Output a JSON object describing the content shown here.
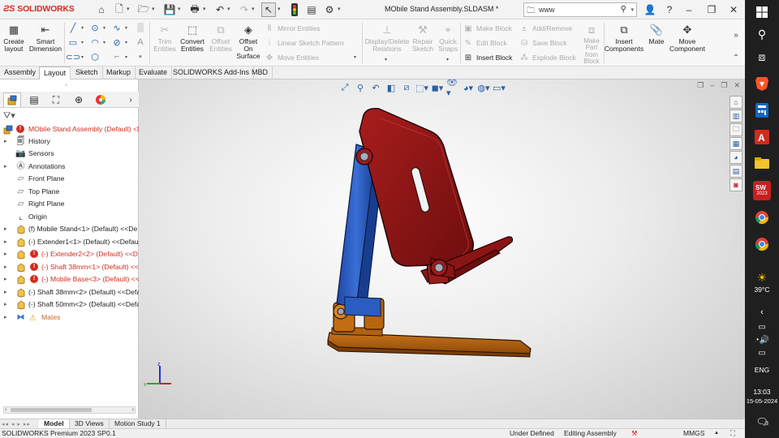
{
  "window": {
    "app_name": "SOLIDWORKS",
    "title": "MObile Stand Assembly.SLDASM *",
    "search_value": "www"
  },
  "ribbon": {
    "create_layout": "Create\nlayout",
    "smart_dimension": "Smart\nDimension",
    "trim_entities": "Trim\nEntities",
    "convert_entities": "Convert\nEntities",
    "offset_entities": "Offset\nEntities",
    "offset_on_surface": "Offset\nOn\nSurface",
    "mirror_entities": "Mirror Entities",
    "linear_sketch_pattern": "Linear Sketch Pattern",
    "move_entities": "Move Entities",
    "display_delete_relations": "Display/Delete\nRelations",
    "repair_sketch": "Repair\nSketch",
    "quick_snaps": "Quick\nSnaps",
    "make_block": "Make Block",
    "edit_block": "Edit Block",
    "insert_block": "Insert Block",
    "add_remove": "Add/Remove",
    "save_block": "Save Block",
    "explode_block": "Explode Block",
    "make_part_from_block": "Make\nPart\nfrom\nBlock",
    "insert_components": "Insert\nComponents",
    "mate": "Mate",
    "move_component": "Move\nComponent"
  },
  "command_tabs": [
    "Assembly",
    "Layout",
    "Sketch",
    "Markup",
    "Evaluate",
    "SOLIDWORKS Add-Ins",
    "MBD"
  ],
  "active_command_tab": "Layout",
  "feature_tree": {
    "root": "MObile Stand Assembly (Default) <Di",
    "items": [
      "History",
      "Sensors",
      "Annotations",
      "Front Plane",
      "Top Plane",
      "Right Plane",
      "Origin",
      "(f) Mobile Stand<1> (Default) <<De",
      "(-) Extender1<1> (Default) <<Defau",
      "(-) Extender2<2> (Default) <<D",
      "(-) Shaft 38mm<1> (Default) <<",
      "(-) Mobile Base<3> (Default) <<",
      "(-) Shaft 38mm<2> (Default) <<Defa",
      "(-) Shaft 50mm<2> (Default) <<Defa",
      "Mates"
    ]
  },
  "bottom_tabs": [
    "Model",
    "3D Views",
    "Motion Study 1"
  ],
  "active_bottom_tab": "Model",
  "status": {
    "version": "SOLIDWORKS Premium 2023 SP0.1",
    "definition": "Under Defined",
    "mode": "Editing Assembly",
    "units": "MMGS"
  },
  "taskbar": {
    "weather": "39°C",
    "language": "ENG",
    "time": "13:03",
    "date": "15-05-2024",
    "notifications": "3",
    "sw_badge": "2023"
  },
  "colors": {
    "stand_red": "#8b1414",
    "extender_blue": "#2456b8",
    "base_orange": "#b5630f",
    "sw_red": "#d52b1e"
  }
}
